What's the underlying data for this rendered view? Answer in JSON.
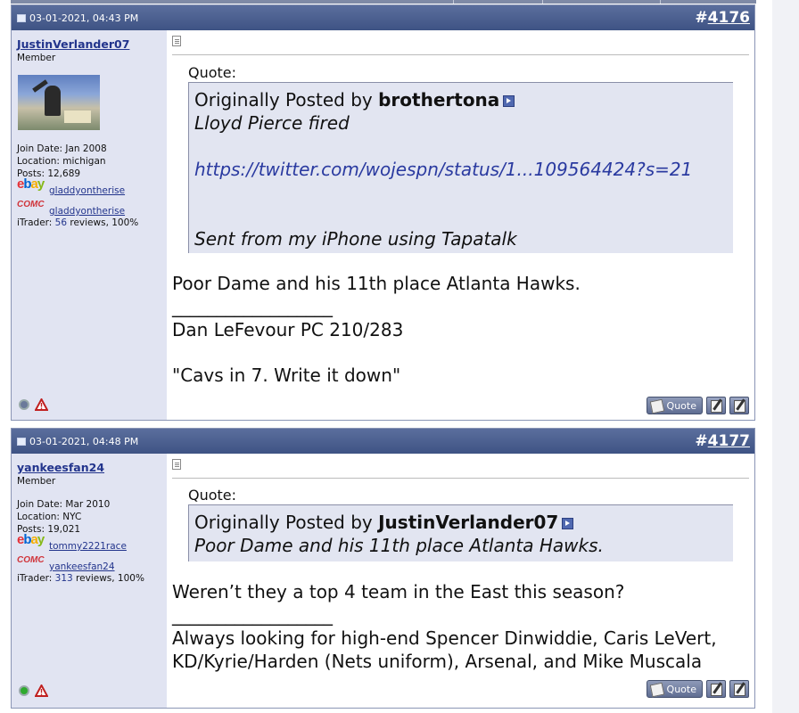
{
  "posts": [
    {
      "date": "03-01-2021, 04:43 PM",
      "number": "4176",
      "number_prefix": "#",
      "user": {
        "name": "JustinVerlander07",
        "title": "Member",
        "join_date": "Join Date: Jan 2008",
        "location": "Location: michigan",
        "posts": "Posts: 12,689",
        "ebay_handle": "gladdyontherise",
        "comc_handle": "gladdyontherise",
        "itrader_prefix": "iTrader: ",
        "itrader_count": "56",
        "itrader_suffix": " reviews, 100%",
        "online": false
      },
      "quote": {
        "label": "Quote:",
        "posted_by_prefix": "Originally Posted by ",
        "author": "brothertona",
        "lines": [
          "Lloyd Pierce fired",
          "",
          "https://twitter.com/wojespn/status/1...109564424?s=21",
          "",
          "",
          "Sent from my iPhone using Tapatalk"
        ]
      },
      "body": "Poor Dame and his 11th place Atlanta Hawks.",
      "signature_rule": "__________________",
      "signature": [
        "Dan LeFevour PC 210/283",
        "",
        "\"Cavs in 7. Write it down\""
      ]
    },
    {
      "date": "03-01-2021, 04:48 PM",
      "number": "4177",
      "number_prefix": "#",
      "user": {
        "name": "yankeesfan24",
        "title": "Member",
        "join_date": "Join Date: Mar 2010",
        "location": "Location: NYC",
        "posts": "Posts: 19,021",
        "ebay_handle": "tommy2221race",
        "comc_handle": "yankeesfan24",
        "itrader_prefix": "iTrader: ",
        "itrader_count": "313",
        "itrader_suffix": " reviews, 100%",
        "online": true
      },
      "quote": {
        "label": "Quote:",
        "posted_by_prefix": "Originally Posted by ",
        "author": "JustinVerlander07",
        "lines": [
          "Poor Dame and his 11th place Atlanta Hawks."
        ]
      },
      "body": "Weren’t they a top 4 team in the East this season?",
      "signature_rule": "__________________",
      "signature": [
        "Always looking for high-end Spencer Dinwiddie, Caris LeVert,",
        "KD/Kyrie/Harden (Nets uniform), Arsenal, and Mike Muscala"
      ]
    }
  ],
  "labels": {
    "quote_button": "Quote",
    "ebay": {
      "e": "e",
      "b": "b",
      "a": "a",
      "y": "y"
    },
    "comc": "COMC"
  },
  "colors": {
    "header": "#4a5c8c",
    "userinfo_bg": "#e1e4f2",
    "link": "#22348c",
    "quote_bg": "#e2e5f1"
  },
  "icons": [
    "doc-icon",
    "post-icon",
    "status-dot-icon",
    "report-warning-icon",
    "multiquote-icon",
    "edit-icon",
    "quote-arrow-icon"
  ]
}
